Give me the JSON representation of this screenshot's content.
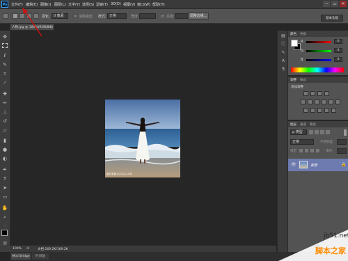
{
  "app": {
    "logo_text": "Ps",
    "menus": [
      "文件(F)",
      "编辑(E)",
      "图像(I)",
      "图层(L)",
      "文字(Y)",
      "选择(S)",
      "滤镜(T)",
      "3D(D)",
      "视图(V)",
      "窗口(W)",
      "帮助(H)"
    ]
  },
  "window_buttons": {
    "minimize": "−",
    "restore": "▭",
    "close": "✕"
  },
  "options_bar": {
    "feather_label": "羽化:",
    "feather_value": "0 像素",
    "antialias_label": "消除锯齿",
    "style_label": "样式:",
    "style_value": "正常",
    "width_label": "宽度:",
    "height_label": "高度:",
    "refine_edge_button": "调整边缘...",
    "workspace_button": "基本功能"
  },
  "document": {
    "tab_title": "人物.jpg @ 100%(RGB/8#)",
    "tab_close": "×",
    "photo_caption": "图片来源 ZCOOL.COM"
  },
  "status": {
    "zoom": "100%",
    "doc_size": "文档:169.2K/169.2K",
    "mini_bridge": "Mini Bridge",
    "timeline": "时间轴"
  },
  "panels": {
    "color_tab": "颜色",
    "swatches_tab": "色板",
    "r_label": "R",
    "g_label": "G",
    "b_label": "B",
    "r_value": "0",
    "g_value": "0",
    "b_value": "0",
    "adjustments_tab": "调整",
    "styles_tab": "样式",
    "add_adjustment_label": "添加调整",
    "layers_tab": "图层",
    "channels_tab": "通道",
    "paths_tab": "路径",
    "kind_label": "ρ 类型",
    "blend_mode": "正常",
    "opacity_label": "不透明度:",
    "lock_label": "锁定:",
    "fill_label": "填充:",
    "layer_name": "背景"
  },
  "watermark": {
    "site": "jb51.net",
    "name": "脚本之家"
  },
  "colors": {
    "accent_blue": "#3ba6ff",
    "selected_layer": "#6e7bb0",
    "annotation_arrow": "#d01010"
  }
}
